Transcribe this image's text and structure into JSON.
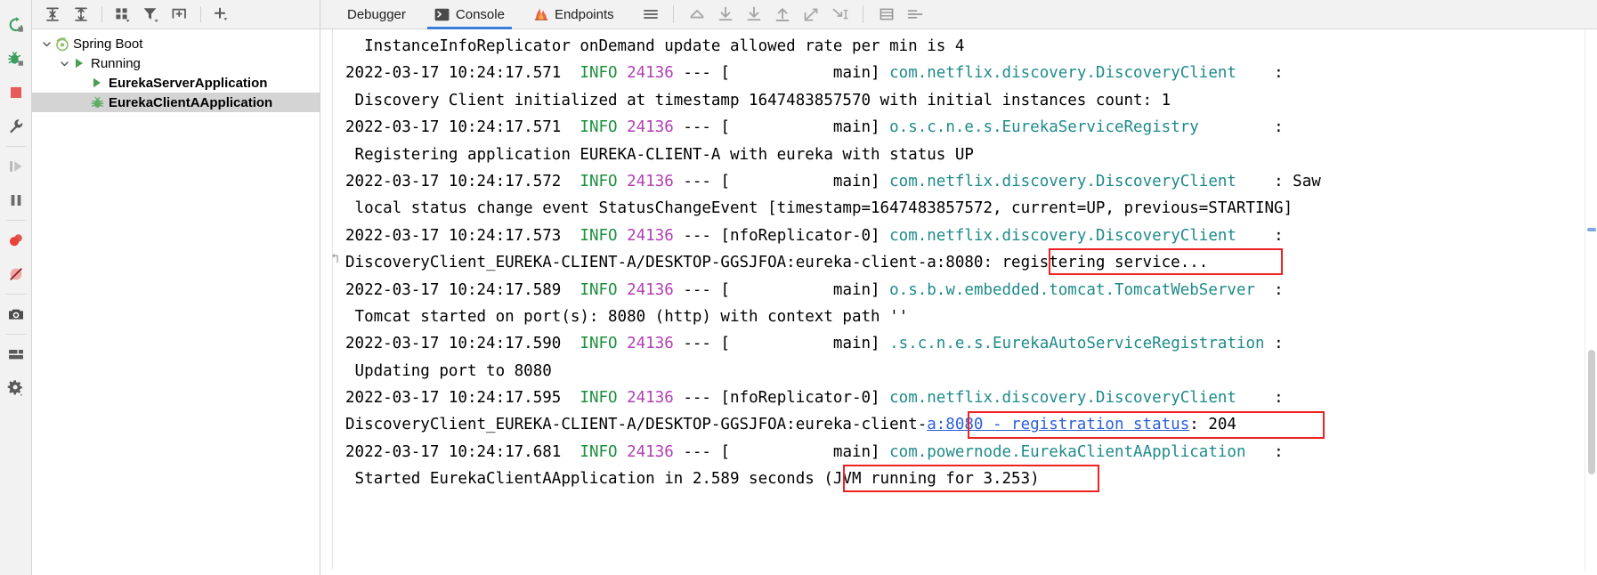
{
  "run_rail": {
    "buttons": [
      {
        "name": "rerun-button",
        "icon": "rerun-icon",
        "tooltip": "Rerun"
      },
      {
        "name": "debug-button",
        "icon": "debug-icon",
        "tooltip": "Debug"
      },
      {
        "name": "stop-button",
        "icon": "stop-icon",
        "tooltip": "Stop"
      },
      {
        "name": "settings-wrench-button",
        "icon": "wrench-icon",
        "tooltip": "Settings"
      },
      {
        "name": "resume-program-button",
        "icon": "resume-icon",
        "tooltip": "Resume Program"
      },
      {
        "name": "pause-program-button",
        "icon": "pause-icon",
        "tooltip": "Pause Program"
      },
      {
        "name": "view-breakpoints-button",
        "icon": "breakpoint-icon",
        "tooltip": "View Breakpoints"
      },
      {
        "name": "mute-breakpoints-button",
        "icon": "mute-breakpoint-icon",
        "tooltip": "Mute Breakpoints"
      },
      {
        "name": "screenshot-button",
        "icon": "camera-icon",
        "tooltip": "Get Thread Dump"
      },
      {
        "name": "layout-settings-button",
        "icon": "layout-icon",
        "tooltip": "Layout Settings"
      },
      {
        "name": "gear-settings-button",
        "icon": "gear-icon",
        "tooltip": "Settings"
      }
    ]
  },
  "tree_toolbar": {
    "buttons": [
      {
        "name": "expand-all-button",
        "icon": "expand-all-icon",
        "label": "Expand All"
      },
      {
        "name": "collapse-all-button",
        "icon": "collapse-all-icon",
        "label": "Collapse All"
      },
      {
        "name": "group-by-button",
        "icon": "group-by-icon",
        "label": "Group By"
      },
      {
        "name": "filter-button",
        "icon": "filter-icon",
        "label": "Filter"
      },
      {
        "name": "new-frame-button",
        "icon": "add-frame-icon",
        "label": "New Frame"
      },
      {
        "name": "add-button",
        "icon": "plus-icon",
        "label": "Add"
      }
    ]
  },
  "tree": {
    "nodes": [
      {
        "label": "Spring Boot",
        "icon": "spring-boot-icon",
        "indent": 0,
        "twisty": "expanded",
        "bold": false,
        "selected": false
      },
      {
        "label": "Running",
        "icon": "run-green-arrow-icon",
        "indent": 1,
        "twisty": "expanded",
        "bold": false,
        "selected": false
      },
      {
        "label": "EurekaServerApplication",
        "icon": "run-green-arrow-icon",
        "indent": 2,
        "twisty": "none",
        "bold": true,
        "selected": false
      },
      {
        "label": "EurekaClientAApplication",
        "icon": "spring-leaf-icon",
        "indent": 2,
        "twisty": "none",
        "bold": true,
        "selected": true
      }
    ]
  },
  "tabs": {
    "items": [
      {
        "label": "Debugger",
        "icon": "none",
        "active": false
      },
      {
        "label": "Console",
        "icon": "console-terminal-icon",
        "active": true
      },
      {
        "label": "Endpoints",
        "icon": "endpoints-icon",
        "active": false
      }
    ],
    "menu_label": "Show Options Menu",
    "step_buttons": [
      {
        "name": "step-out-button",
        "icon": "step-out-icon"
      },
      {
        "name": "step-over-button",
        "icon": "step-over-icon"
      },
      {
        "name": "step-into-button",
        "icon": "step-into-icon"
      },
      {
        "name": "force-step-into-button",
        "icon": "force-step-into-icon"
      },
      {
        "name": "drop-frame-button",
        "icon": "drop-frame-icon"
      },
      {
        "name": "run-to-cursor-button",
        "icon": "run-to-cursor-icon"
      }
    ],
    "right_buttons": [
      {
        "name": "soft-wrap-button",
        "icon": "soft-wrap-icon"
      },
      {
        "name": "format-button",
        "icon": "align-lines-icon"
      }
    ]
  },
  "console": {
    "lines": [
      [
        {
          "t": "  InstanceInfoReplicator onDemand update allowed rate per min is 4",
          "c": "plain"
        }
      ],
      [
        {
          "t": "2022-03-17 10:24:17.571  ",
          "c": "plain"
        },
        {
          "t": "INFO",
          "c": "info"
        },
        {
          "t": " ",
          "c": "plain"
        },
        {
          "t": "24136",
          "c": "pid"
        },
        {
          "t": " --- [           main] ",
          "c": "plain"
        },
        {
          "t": "com.netflix.discovery.DiscoveryClient",
          "c": "cls"
        },
        {
          "t": "    :",
          "c": "plain"
        }
      ],
      [
        {
          "t": " Discovery Client initialized at timestamp 1647483857570 with initial instances count: 1",
          "c": "plain"
        }
      ],
      [
        {
          "t": "2022-03-17 10:24:17.571  ",
          "c": "plain"
        },
        {
          "t": "INFO",
          "c": "info"
        },
        {
          "t": " ",
          "c": "plain"
        },
        {
          "t": "24136",
          "c": "pid"
        },
        {
          "t": " --- [           main] ",
          "c": "plain"
        },
        {
          "t": "o.s.c.n.e.s.EurekaServiceRegistry",
          "c": "cls"
        },
        {
          "t": "        :",
          "c": "plain"
        }
      ],
      [
        {
          "t": " Registering application EUREKA-CLIENT-A with eureka with status UP",
          "c": "plain"
        }
      ],
      [
        {
          "t": "2022-03-17 10:24:17.572  ",
          "c": "plain"
        },
        {
          "t": "INFO",
          "c": "info"
        },
        {
          "t": " ",
          "c": "plain"
        },
        {
          "t": "24136",
          "c": "pid"
        },
        {
          "t": " --- [           main] ",
          "c": "plain"
        },
        {
          "t": "com.netflix.discovery.DiscoveryClient",
          "c": "cls"
        },
        {
          "t": "    : Saw",
          "c": "plain"
        }
      ],
      [
        {
          "t": " local status change event StatusChangeEvent [timestamp=1647483857572, current=UP, previous=STARTING]",
          "c": "plain"
        }
      ],
      [
        {
          "t": "2022-03-17 10:24:17.573  ",
          "c": "plain"
        },
        {
          "t": "INFO",
          "c": "info"
        },
        {
          "t": " ",
          "c": "plain"
        },
        {
          "t": "24136",
          "c": "pid"
        },
        {
          "t": " --- [nfoReplicator-0] ",
          "c": "plain"
        },
        {
          "t": "com.netflix.discovery.DiscoveryClient",
          "c": "cls"
        },
        {
          "t": "    :",
          "c": "plain"
        }
      ],
      [
        {
          "t": "DiscoveryClient_EUREKA-CLIENT-A/DESKTOP-GGSJFOA:eureka-client-a:8080: registering service...",
          "c": "plain"
        }
      ],
      [
        {
          "t": "2022-03-17 10:24:17.589  ",
          "c": "plain"
        },
        {
          "t": "INFO",
          "c": "info"
        },
        {
          "t": " ",
          "c": "plain"
        },
        {
          "t": "24136",
          "c": "pid"
        },
        {
          "t": " --- [           main] ",
          "c": "plain"
        },
        {
          "t": "o.s.b.w.embedded.tomcat.TomcatWebServer",
          "c": "cls"
        },
        {
          "t": "  :",
          "c": "plain"
        }
      ],
      [
        {
          "t": " Tomcat started on port(s): 8080 (http) with context path ''",
          "c": "plain"
        }
      ],
      [
        {
          "t": "2022-03-17 10:24:17.590  ",
          "c": "plain"
        },
        {
          "t": "INFO",
          "c": "info"
        },
        {
          "t": " ",
          "c": "plain"
        },
        {
          "t": "24136",
          "c": "pid"
        },
        {
          "t": " --- [           main] ",
          "c": "plain"
        },
        {
          "t": ".s.c.n.e.s.EurekaAutoServiceRegistration",
          "c": "cls"
        },
        {
          "t": " :",
          "c": "plain"
        }
      ],
      [
        {
          "t": " Updating port to 8080",
          "c": "plain"
        }
      ],
      [
        {
          "t": "2022-03-17 10:24:17.595  ",
          "c": "plain"
        },
        {
          "t": "INFO",
          "c": "info"
        },
        {
          "t": " ",
          "c": "plain"
        },
        {
          "t": "24136",
          "c": "pid"
        },
        {
          "t": " --- [nfoReplicator-0] ",
          "c": "plain"
        },
        {
          "t": "com.netflix.discovery.DiscoveryClient",
          "c": "cls"
        },
        {
          "t": "    :",
          "c": "plain"
        }
      ],
      [
        {
          "t": "DiscoveryClient_EUREKA-CLIENT-A/DESKTOP-GGSJFOA:eureka-client-",
          "c": "plain"
        },
        {
          "t": "a:8080 - registration status",
          "c": "link"
        },
        {
          "t": ": 204",
          "c": "plain"
        }
      ],
      [
        {
          "t": "2022-03-17 10:24:17.681  ",
          "c": "plain"
        },
        {
          "t": "INFO",
          "c": "info"
        },
        {
          "t": " ",
          "c": "plain"
        },
        {
          "t": "24136",
          "c": "pid"
        },
        {
          "t": " --- [           main] ",
          "c": "plain"
        },
        {
          "t": "com.powernode.EurekaClientAApplication",
          "c": "cls"
        },
        {
          "t": "   :",
          "c": "plain"
        }
      ],
      [
        {
          "t": " Started EurekaClientAApplication in 2.589 seconds (JVM running for 3.253)",
          "c": "plain"
        }
      ]
    ],
    "annotations": [
      {
        "name": "annotation-registering-service",
        "text": "registering service...",
        "color": "#ee2222"
      },
      {
        "name": "annotation-registration-status",
        "text": "a:8080 - registration status",
        "color": "#ee2222"
      },
      {
        "name": "annotation-jvm-running",
        "text": "(JVM running for 3.253)",
        "color": "#ee2222"
      }
    ]
  },
  "colors": {
    "info": "#1a8f3c",
    "pid": "#b23fb2",
    "logger": "#1f8a8a",
    "link": "#2b5fd9",
    "annotation": "#ee2222",
    "tab_underline": "#3b7ddd",
    "selection": "#d4d4d4"
  }
}
